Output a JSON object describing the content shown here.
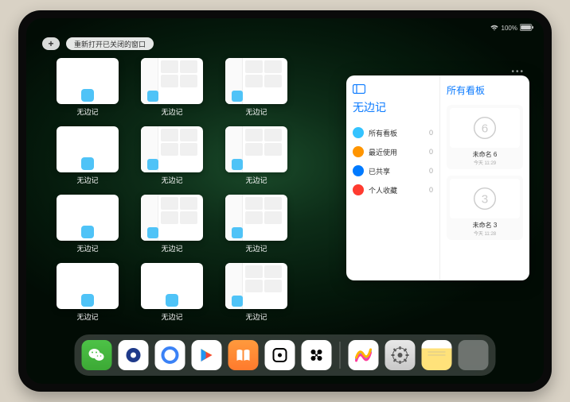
{
  "status": {
    "time": "",
    "indicators": "📶 100% 🔋"
  },
  "toolbar": {
    "add": "+",
    "reopen": "重新打开已关闭的窗口"
  },
  "tiles": [
    {
      "label": "无边记",
      "type": "blank"
    },
    {
      "label": "无边记",
      "type": "detail"
    },
    {
      "label": "无边记",
      "type": "detail"
    },
    {
      "label": "无边记",
      "type": "blank"
    },
    {
      "label": "无边记",
      "type": "detail"
    },
    {
      "label": "无边记",
      "type": "detail"
    },
    {
      "label": "无边记",
      "type": "blank"
    },
    {
      "label": "无边记",
      "type": "detail"
    },
    {
      "label": "无边记",
      "type": "detail"
    },
    {
      "label": "无边记",
      "type": "blank"
    },
    {
      "label": "无边记",
      "type": "blank"
    },
    {
      "label": "无边记",
      "type": "detail"
    }
  ],
  "panel": {
    "title": "无边记",
    "right_title": "所有看板",
    "categories": [
      {
        "label": "所有看板",
        "count": "0",
        "color": "#34c3ff"
      },
      {
        "label": "最近使用",
        "count": "0",
        "color": "#ff9500"
      },
      {
        "label": "已共享",
        "count": "0",
        "color": "#007aff"
      },
      {
        "label": "个人收藏",
        "count": "0",
        "color": "#ff3b30"
      }
    ],
    "boards": [
      {
        "name": "未命名 6",
        "time": "今天 11:29",
        "digit": "6"
      },
      {
        "name": "未命名 3",
        "time": "今天 11:28",
        "digit": "3"
      }
    ]
  },
  "dock": {
    "apps": [
      "wechat",
      "qq1",
      "qq2",
      "play",
      "books",
      "dice",
      "octo",
      "freeform",
      "settings",
      "notes"
    ]
  }
}
